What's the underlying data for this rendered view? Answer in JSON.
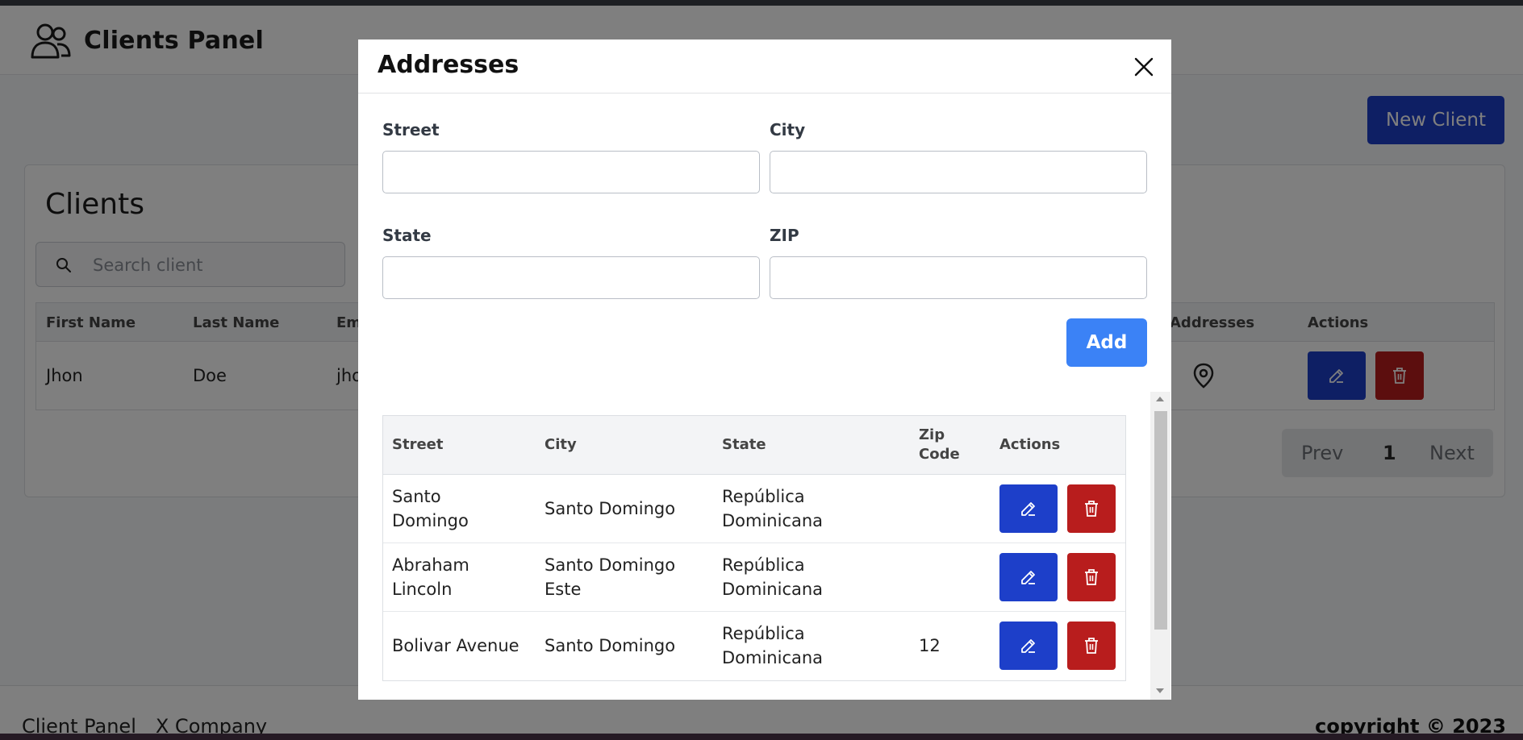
{
  "header": {
    "title": "Clients Panel",
    "icon": "users-icon"
  },
  "new_client_label": "New Client",
  "clients": {
    "title": "Clients",
    "search_placeholder": "Search client",
    "columns": [
      "First Name",
      "Last Name",
      "Em",
      "Addresses",
      "Actions"
    ],
    "rows": [
      {
        "first": "Jhon",
        "last": "Doe",
        "email": "jho"
      }
    ]
  },
  "pagination": {
    "prev": "Prev",
    "page": "1",
    "next": "Next"
  },
  "footer": {
    "left_1": "Client Panel",
    "left_2": "X Company",
    "right": "copyright © 2023"
  },
  "modal": {
    "title": "Addresses",
    "fields": {
      "street": {
        "label": "Street",
        "value": ""
      },
      "city": {
        "label": "City",
        "value": ""
      },
      "state": {
        "label": "State",
        "value": ""
      },
      "zip": {
        "label": "ZIP",
        "value": ""
      }
    },
    "add_label": "Add",
    "table": {
      "columns": [
        "Street",
        "City",
        "State",
        "Zip Code",
        "Actions"
      ],
      "rows": [
        {
          "street": "Santo Domingo",
          "city": "Santo Domingo",
          "state": "República Dominicana",
          "zip": ""
        },
        {
          "street": "Abraham Lincoln",
          "city": "Santo Domingo Este",
          "state": "República Dominicana",
          "zip": ""
        },
        {
          "street": "Bolivar Avenue",
          "city": "Santo Domingo",
          "state": "República Dominicana",
          "zip": "12"
        }
      ]
    }
  },
  "colors": {
    "primary": "#1d3fc9",
    "danger": "#b81d1d",
    "add": "#3b82f6"
  }
}
